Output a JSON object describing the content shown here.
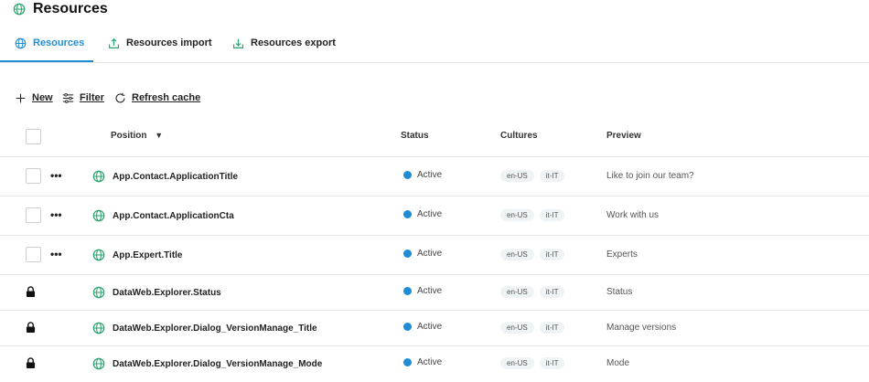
{
  "header": {
    "title": "Resources"
  },
  "tabs": [
    {
      "label": "Resources",
      "active": true
    },
    {
      "label": "Resources import",
      "active": false
    },
    {
      "label": "Resources export",
      "active": false
    }
  ],
  "toolbar": {
    "new_label": "New",
    "filter_label": "Filter",
    "refresh_label": "Refresh cache"
  },
  "table": {
    "columns": {
      "position": "Position",
      "sort_indicator": "▼",
      "status": "Status",
      "cultures": "Cultures",
      "preview": "Preview"
    },
    "rows": [
      {
        "position": "App.Contact.ApplicationTitle",
        "status": "Active",
        "cultures": [
          "en-US",
          "it-IT"
        ],
        "preview": "Like to join our team?",
        "locked": false
      },
      {
        "position": "App.Contact.ApplicationCta",
        "status": "Active",
        "cultures": [
          "en-US",
          "it-IT"
        ],
        "preview": "Work with us",
        "locked": false
      },
      {
        "position": "App.Expert.Title",
        "status": "Active",
        "cultures": [
          "en-US",
          "it-IT"
        ],
        "preview": "Experts",
        "locked": false
      },
      {
        "position": "DataWeb.Explorer.Status",
        "status": "Active",
        "cultures": [
          "en-US",
          "it-IT"
        ],
        "preview": "Status",
        "locked": true
      },
      {
        "position": "DataWeb.Explorer.Dialog_VersionManage_Title",
        "status": "Active",
        "cultures": [
          "en-US",
          "it-IT"
        ],
        "preview": "Manage versions",
        "locked": true
      },
      {
        "position": "DataWeb.Explorer.Dialog_VersionManage_Mode",
        "status": "Active",
        "cultures": [
          "en-US",
          "it-IT"
        ],
        "preview": "Mode",
        "locked": true
      }
    ],
    "more_label": "•••"
  },
  "colors": {
    "accent": "#1f8dd6",
    "status_active": "#1f8dd6",
    "chip_bg": "#eef3f6",
    "row_divider": "#e6e6e6"
  },
  "icons": {
    "title": "globe-icon",
    "row": "globe-icon",
    "import": "upload-icon",
    "export": "download-icon",
    "new": "plus-icon",
    "filter": "filter-lines-icon",
    "refresh": "refresh-icon",
    "lock": "lock-icon"
  }
}
